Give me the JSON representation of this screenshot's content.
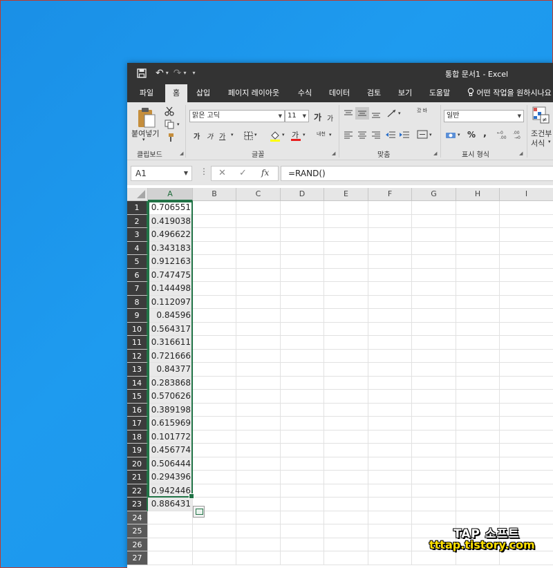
{
  "window": {
    "title": "통합 문서1  -  Excel"
  },
  "tabs": [
    "파일",
    "홈",
    "삽입",
    "페이지 레이아웃",
    "수식",
    "데이터",
    "검토",
    "보기",
    "도움말"
  ],
  "active_tab": "홈",
  "tell_me": "어떤 작업을 원하시나요",
  "ribbon": {
    "clipboard": {
      "paste_label": "붙여넣기",
      "group_label": "클립보드"
    },
    "font": {
      "name": "맑은 고딕",
      "size": "11",
      "group_label": "글꼴",
      "grow": "가",
      "shrink": "가",
      "bold": "가",
      "italic": "가",
      "underline": "가",
      "font_color_label": "가",
      "phonetic": "내천"
    },
    "alignment": {
      "group_label": "맞춤",
      "wrap": "갔 바"
    },
    "number": {
      "format": "일반",
      "group_label": "표시 형식",
      "percent": "%",
      "comma": ","
    },
    "styles": {
      "conditional_label_1": "조건부",
      "conditional_label_2": "서식"
    }
  },
  "formula_bar": {
    "name_box": "A1",
    "fx": "fx",
    "formula": "=RAND()"
  },
  "columns": [
    "A",
    "B",
    "C",
    "D",
    "E",
    "F",
    "G",
    "H",
    "I"
  ],
  "rows": [
    "1",
    "2",
    "3",
    "4",
    "5",
    "6",
    "7",
    "8",
    "9",
    "10",
    "11",
    "12",
    "13",
    "14",
    "15",
    "16",
    "17",
    "18",
    "19",
    "20",
    "21",
    "22",
    "23",
    "24",
    "25",
    "26",
    "27"
  ],
  "values": [
    "0.706551",
    "0.419038",
    "0.496622",
    "0.343183",
    "0.912163",
    "0.747475",
    "0.144498",
    "0.112097",
    "0.84596",
    "0.564317",
    "0.316611",
    "0.721666",
    "0.84377",
    "0.283868",
    "0.570626",
    "0.389198",
    "0.615969",
    "0.101772",
    "0.456774",
    "0.506444",
    "0.294396",
    "0.942446",
    "0.886431"
  ],
  "watermark": {
    "line1": "TAP 소프트",
    "line2": "tttap.tistory.com"
  },
  "colors": {
    "excel_green": "#217346",
    "title_bar": "#333333",
    "ribbon_bg": "#e6e6e6",
    "desktop": "#1e9bef"
  }
}
